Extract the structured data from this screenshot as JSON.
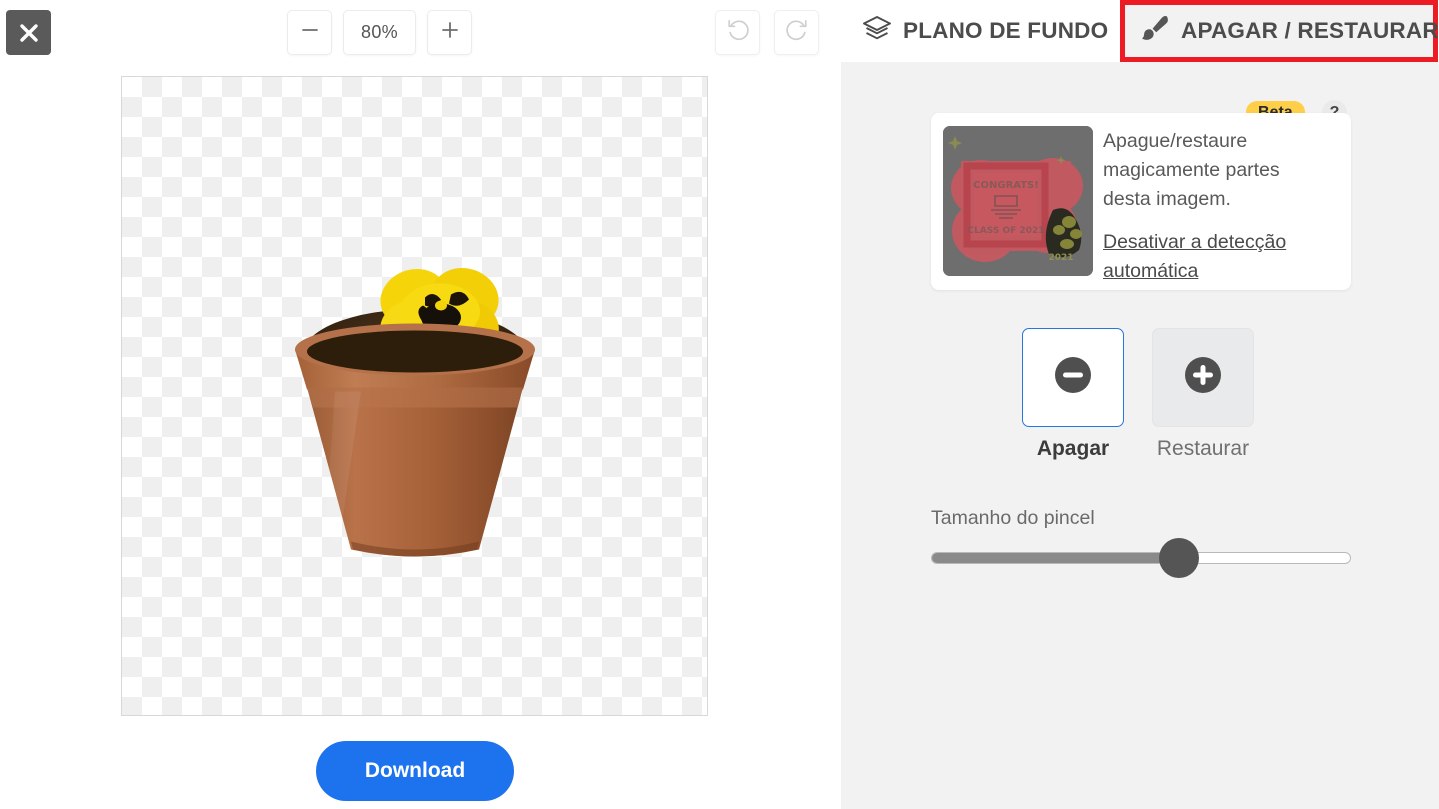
{
  "toolbar": {
    "close_label": "×",
    "close_icon": "close-icon",
    "zoom_out_label": "−",
    "zoom_value": "80%",
    "zoom_in_label": "+",
    "undo_icon": "undo-icon",
    "redo_icon": "redo-icon"
  },
  "canvas": {
    "image_alt": "flower-pot-with-yellow-pansy",
    "background": "transparent-checkerboard"
  },
  "actions": {
    "download_label": "Download"
  },
  "panel": {
    "tabs": [
      {
        "label": "PLANO DE FUNDO",
        "icon": "layers-icon",
        "active": false
      },
      {
        "label": "APAGAR / RESTAURAR",
        "icon": "brush-icon",
        "active": true
      }
    ],
    "info": {
      "badge": "Beta",
      "help": "?",
      "description": "Apague/restaure magicamente partes desta imagem.",
      "link": "Desativar a detecção automática",
      "thumbnail_alt": "congrats-class-of-2021-sign"
    },
    "modes": [
      {
        "label": "Apagar",
        "icon": "minus-circle-icon",
        "selected": true
      },
      {
        "label": "Restaurar",
        "icon": "plus-circle-icon",
        "selected": false
      }
    ],
    "brush": {
      "label": "Tamanho do pincel",
      "value_percent": 59
    }
  },
  "colors": {
    "accent_blue": "#1d72ed",
    "highlight_red": "#ed1c24",
    "beta_yellow": "#ffcf4a",
    "panel_bg": "#f2f2f2",
    "selected_border": "#2477dd"
  }
}
